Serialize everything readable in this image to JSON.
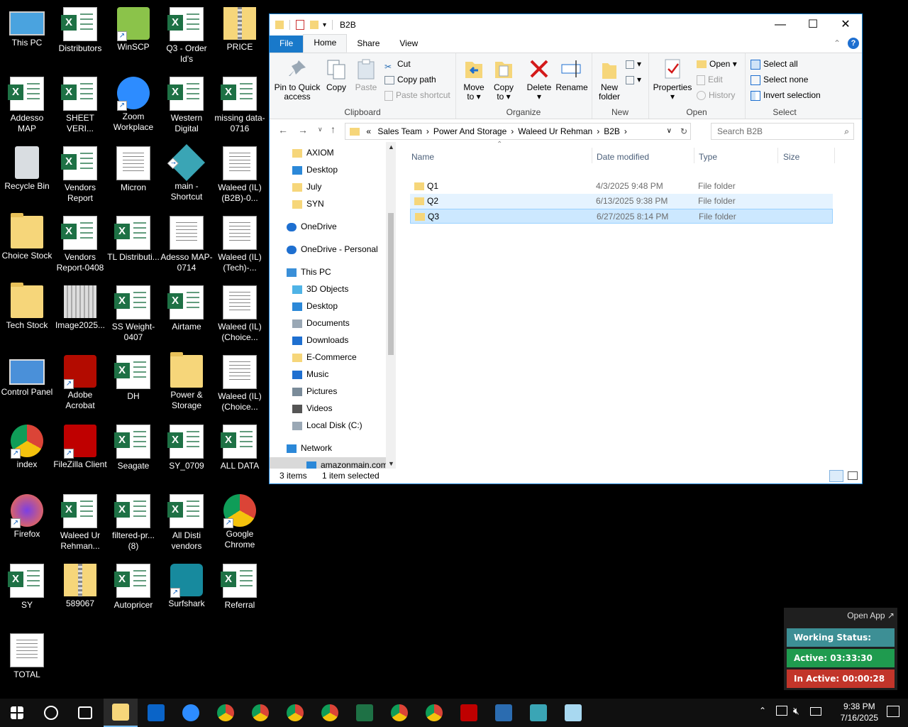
{
  "desktop": {
    "icons": [
      {
        "label": "This PC",
        "type": "pc"
      },
      {
        "label": "Distributors",
        "type": "excel"
      },
      {
        "label": "WinSCP",
        "type": "winscp"
      },
      {
        "label": "Q3 - Order Id's",
        "type": "excel"
      },
      {
        "label": "PRICE",
        "type": "zip"
      },
      {
        "label": "Addesso MAP",
        "type": "excel"
      },
      {
        "label": "SHEET VERI...",
        "type": "excel"
      },
      {
        "label": "Zoom Workplace",
        "type": "zoom"
      },
      {
        "label": "Western Digital",
        "type": "excel"
      },
      {
        "label": "missing data-0716",
        "type": "excel"
      },
      {
        "label": "Recycle Bin",
        "type": "recycle"
      },
      {
        "label": "Vendors Report",
        "type": "excel"
      },
      {
        "label": "Micron",
        "type": "doc"
      },
      {
        "label": "main - Shortcut",
        "type": "app"
      },
      {
        "label": "Waleed (IL)(B2B)-0...",
        "type": "doc"
      },
      {
        "label": "Choice Stock",
        "type": "folder"
      },
      {
        "label": "Vendors Report-0408",
        "type": "excel"
      },
      {
        "label": "TL Distributi...",
        "type": "excel"
      },
      {
        "label": "Adesso MAP-0714",
        "type": "doc"
      },
      {
        "label": "Waleed (IL)(Tech)-...",
        "type": "doc"
      },
      {
        "label": "Tech Stock",
        "type": "folder"
      },
      {
        "label": "Image2025...",
        "type": "image"
      },
      {
        "label": "SS Weight-0407",
        "type": "excel"
      },
      {
        "label": "Airtame",
        "type": "excel"
      },
      {
        "label": "Waleed (IL)(Choice...",
        "type": "doc"
      },
      {
        "label": "Control Panel",
        "type": "control"
      },
      {
        "label": "Adobe Acrobat",
        "type": "acrobat"
      },
      {
        "label": "DH",
        "type": "excel"
      },
      {
        "label": "Power & Storage",
        "type": "folder"
      },
      {
        "label": "Waleed (IL)(Choice...",
        "type": "doc"
      },
      {
        "label": "index",
        "type": "chrome"
      },
      {
        "label": "FileZilla Client",
        "type": "filezilla"
      },
      {
        "label": "Seagate",
        "type": "excel"
      },
      {
        "label": "SY_0709",
        "type": "excel"
      },
      {
        "label": "ALL DATA",
        "type": "excel"
      },
      {
        "label": "Firefox",
        "type": "firefox"
      },
      {
        "label": "Waleed Ur Rehman...",
        "type": "excel"
      },
      {
        "label": "filtered-pr... (8)",
        "type": "excel"
      },
      {
        "label": "All Disti vendors",
        "type": "excel"
      },
      {
        "label": "Google Chrome",
        "type": "chrome"
      },
      {
        "label": "SY",
        "type": "excel"
      },
      {
        "label": "589067",
        "type": "zip"
      },
      {
        "label": "Autopricer",
        "type": "excel"
      },
      {
        "label": "Surfshark",
        "type": "surfshark"
      },
      {
        "label": "Referral",
        "type": "excel"
      },
      {
        "label": "TOTAL",
        "type": "doc"
      }
    ]
  },
  "explorer": {
    "title": "B2B",
    "tabs": [
      "File",
      "Home",
      "Share",
      "View"
    ],
    "ribbon": {
      "clipboard": {
        "pin": "Pin to Quick access",
        "copy": "Copy",
        "paste": "Paste",
        "cut": "Cut",
        "copy_path": "Copy path",
        "paste_shortcut": "Paste shortcut",
        "label": "Clipboard"
      },
      "organize": {
        "move_to": "Move to",
        "copy_to": "Copy to",
        "delete": "Delete",
        "rename": "Rename",
        "label": "Organize"
      },
      "new": {
        "new_folder": "New folder",
        "label": "New"
      },
      "open": {
        "properties": "Properties",
        "open": "Open",
        "edit": "Edit",
        "history": "History",
        "label": "Open"
      },
      "select": {
        "select_all": "Select all",
        "select_none": "Select none",
        "invert": "Invert selection",
        "label": "Select"
      }
    },
    "address": {
      "prefix": "«",
      "crumbs": [
        "Sales Team",
        "Power And Storage",
        "Waleed Ur Rehman",
        "B2B"
      ]
    },
    "search_placeholder": "Search B2B",
    "nav": [
      {
        "label": "AXIOM",
        "icon": "folder"
      },
      {
        "label": "Desktop",
        "icon": "desktop"
      },
      {
        "label": "July",
        "icon": "folder"
      },
      {
        "label": "SYN",
        "icon": "folder"
      },
      {
        "label": "OneDrive",
        "icon": "cloud"
      },
      {
        "label": "OneDrive - Personal",
        "icon": "cloud"
      },
      {
        "label": "This PC",
        "icon": "pc"
      },
      {
        "label": "3D Objects",
        "icon": "cube"
      },
      {
        "label": "Desktop",
        "icon": "desktop"
      },
      {
        "label": "Documents",
        "icon": "docs"
      },
      {
        "label": "Downloads",
        "icon": "download"
      },
      {
        "label": "E-Commerce",
        "icon": "folder"
      },
      {
        "label": "Music",
        "icon": "music"
      },
      {
        "label": "Pictures",
        "icon": "pictures"
      },
      {
        "label": "Videos",
        "icon": "videos"
      },
      {
        "label": "Local Disk (C:)",
        "icon": "disk"
      },
      {
        "label": "Network",
        "icon": "network"
      },
      {
        "label": "amazonmain.comtar",
        "icon": "desktop"
      }
    ],
    "columns": {
      "name": "Name",
      "date": "Date modified",
      "type": "Type",
      "size": "Size"
    },
    "files": [
      {
        "name": "Q1",
        "date": "4/3/2025 9:48 PM",
        "type": "File folder",
        "size": "",
        "state": "normal"
      },
      {
        "name": "Q2",
        "date": "6/13/2025 9:38 PM",
        "type": "File folder",
        "size": "",
        "state": "hover"
      },
      {
        "name": "Q3",
        "date": "6/27/2025 8:14 PM",
        "type": "File folder",
        "size": "",
        "state": "selected"
      }
    ],
    "status": {
      "count": "3 items",
      "selection": "1 item selected"
    }
  },
  "widget": {
    "open_app": "Open App ↗",
    "working_status": "Working Status: Active",
    "active": "Active: 03:33:30",
    "inactive": "In Active: 00:00:28",
    "colors": {
      "status": "#3d8f95",
      "active": "#1f9b4f",
      "inactive": "#c2352a"
    }
  },
  "taskbar": {
    "apps": [
      "Start",
      "Search",
      "Task View",
      "File Explorer",
      "Outlook",
      "Zoom",
      "Chrome",
      "Chrome",
      "Chrome",
      "Chrome",
      "Excel",
      "Chrome",
      "Chrome",
      "FileZilla",
      "Calculator",
      "Main",
      "Notes"
    ],
    "time": "9:38 PM",
    "date": "7/16/2025"
  }
}
